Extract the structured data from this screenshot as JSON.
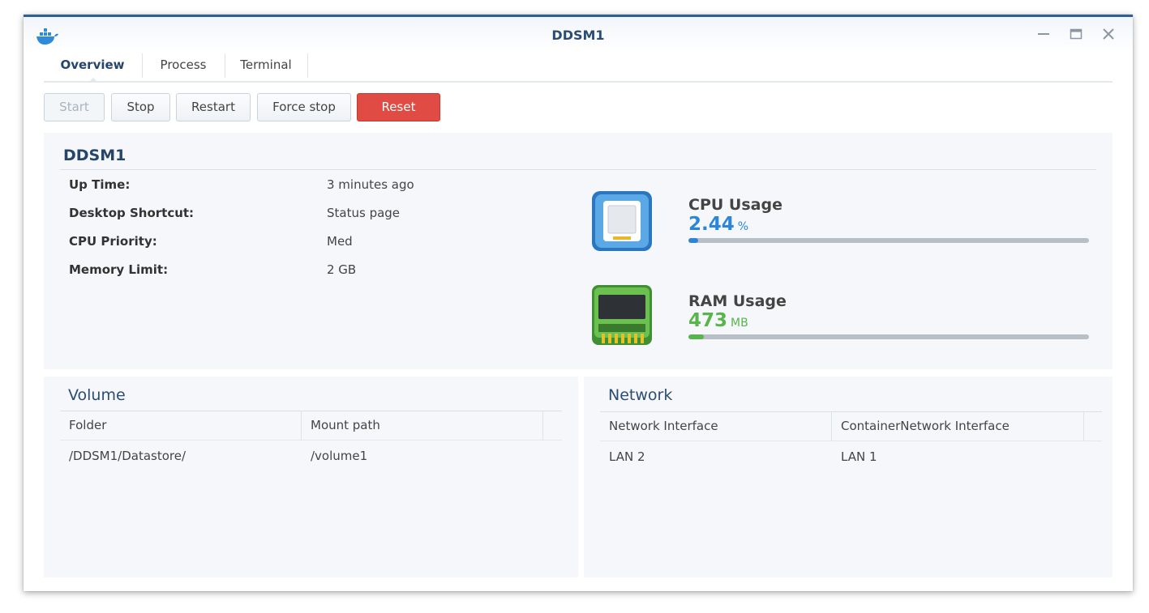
{
  "window": {
    "title": "DDSM1",
    "icon": "docker-whale-icon",
    "controls": [
      "minimize-icon",
      "maximize-icon",
      "close-icon"
    ],
    "accent_color": "#2f5f95"
  },
  "tabs": [
    {
      "label": "Overview",
      "active": true
    },
    {
      "label": "Process",
      "active": false
    },
    {
      "label": "Terminal",
      "active": false
    }
  ],
  "toolbar": {
    "start_label": "Start",
    "stop_label": "Stop",
    "restart_label": "Restart",
    "force_stop_label": "Force stop",
    "reset_label": "Reset",
    "reset_color": "#e04c43"
  },
  "overview": {
    "container_name": "DDSM1",
    "info": [
      {
        "label": "Up Time:",
        "value": "3 minutes ago"
      },
      {
        "label": "Desktop Shortcut:",
        "value": "Status page"
      },
      {
        "label": "CPU Priority:",
        "value": "Med"
      },
      {
        "label": "Memory Limit:",
        "value": "2 GB"
      }
    ],
    "cpu": {
      "title": "CPU Usage",
      "value": "2.44",
      "unit": "%",
      "fraction": 0.0244,
      "color": "#2b86d8",
      "icon": "cpu-chip-icon"
    },
    "ram": {
      "title": "RAM Usage",
      "value": "473",
      "unit": "MB",
      "fraction": 0.038,
      "color": "#57b54b",
      "icon": "ram-module-icon"
    }
  },
  "volume": {
    "title": "Volume",
    "columns": [
      "Folder",
      "Mount path"
    ],
    "rows": [
      [
        "/DDSM1/Datastore/",
        "/volume1"
      ]
    ]
  },
  "network": {
    "title": "Network",
    "columns": [
      "Network Interface",
      "ContainerNetwork Interface"
    ],
    "rows": [
      [
        "LAN 2",
        "LAN 1"
      ]
    ]
  }
}
